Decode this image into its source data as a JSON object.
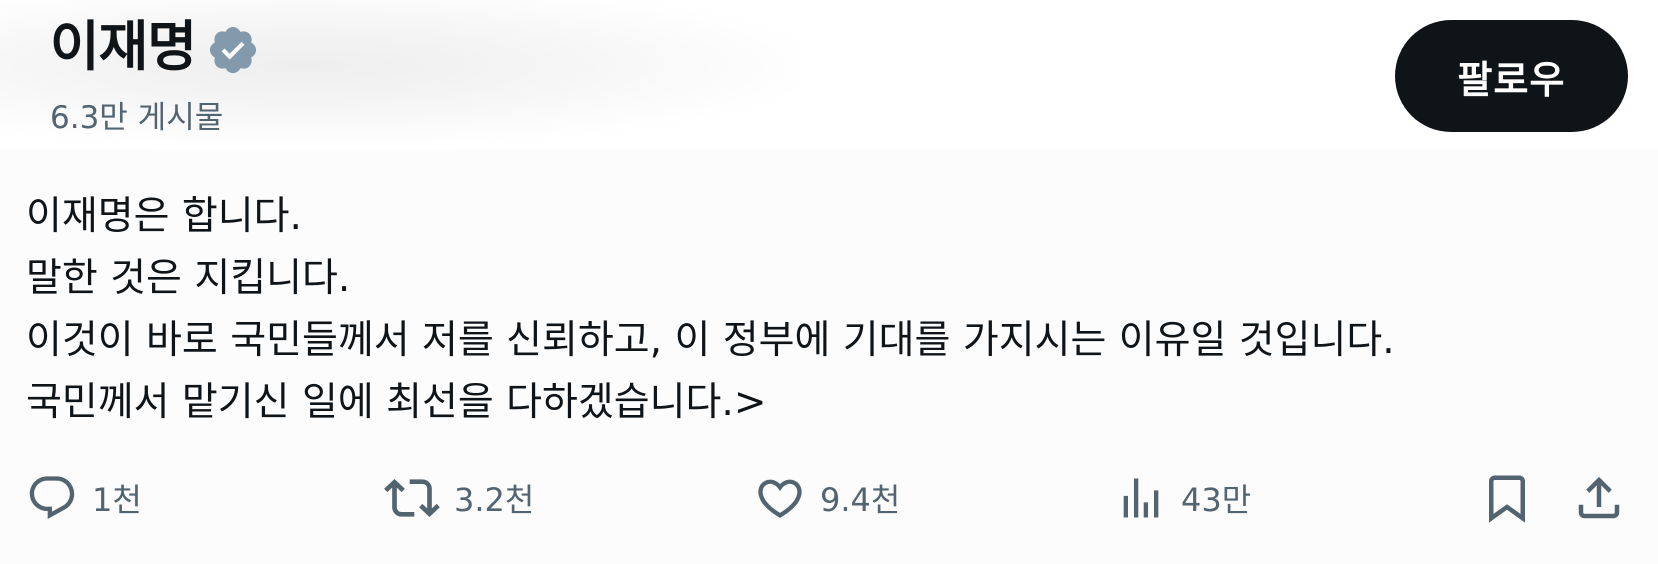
{
  "profile": {
    "display_name": "이재명",
    "post_count": "6.3만 게시물",
    "verified_badge_icon": "verified-badge-icon",
    "badge_color": "#829aab"
  },
  "follow_button": {
    "label": "팔로우"
  },
  "tweet": {
    "lines": [
      "이재명은 합니다.",
      "말한 것은 지킵니다.",
      "이것이 바로 국민들께서 저를 신뢰하고, 이 정부에 기대를 가지시는 이유일 것입니다.",
      "국민께서 맡기신 일에 최선을 다하겠습니다.>"
    ]
  },
  "actions": {
    "reply": {
      "icon": "reply-icon",
      "count": "1천"
    },
    "repost": {
      "icon": "repost-icon",
      "count": "3.2천"
    },
    "like": {
      "icon": "heart-icon",
      "count": "9.4천"
    },
    "views": {
      "icon": "views-icon",
      "count": "43만"
    },
    "bookmark": {
      "icon": "bookmark-icon"
    },
    "share": {
      "icon": "share-icon"
    }
  },
  "colors": {
    "text": "#0f1419",
    "secondary": "#536471",
    "button_bg": "#0f1419",
    "button_text": "#ffffff"
  }
}
